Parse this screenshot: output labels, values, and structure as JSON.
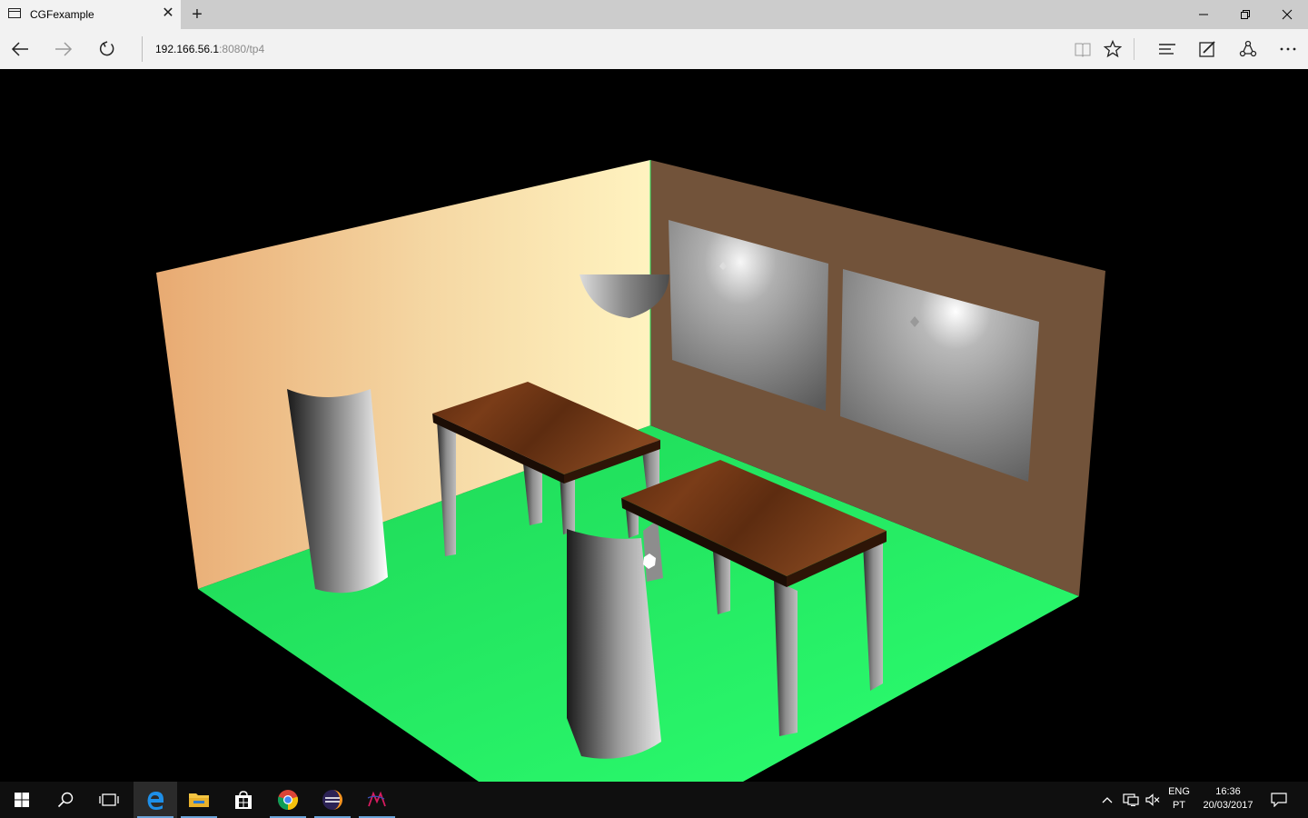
{
  "browser": {
    "tab_title": "CGFexample",
    "url_host": "192.166.56.1",
    "url_rest": ":8080/tp4"
  },
  "icons": {
    "back": "back-arrow-icon",
    "forward": "forward-arrow-icon",
    "refresh": "refresh-icon",
    "reading_view": "reading-view-icon",
    "favorite": "star-icon",
    "hub": "hub-icon",
    "web_note": "web-note-icon",
    "share": "share-icon",
    "more": "more-icon"
  },
  "taskbar": {
    "lang_line1": "ENG",
    "lang_line2": "PT",
    "time": "16:36",
    "date": "20/03/2017"
  },
  "colors": {
    "floor": "#22ee66",
    "left_wall_a": "#e9ad74",
    "left_wall_b": "#fdf0b0",
    "right_wall": "#73533a",
    "table_top": "#6a2f10",
    "accent_edge": "#0078d7"
  }
}
